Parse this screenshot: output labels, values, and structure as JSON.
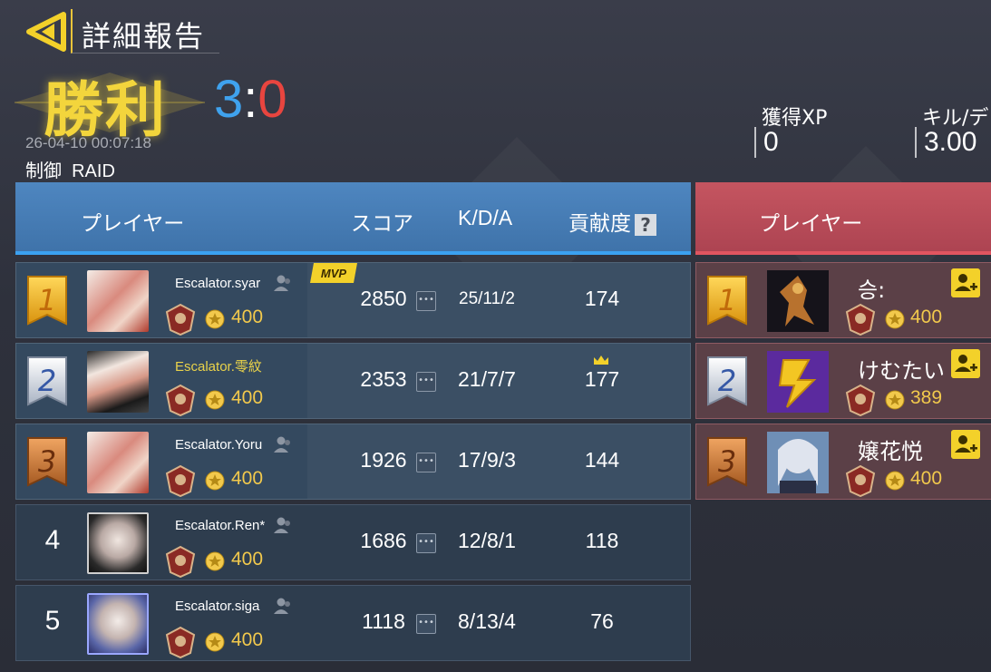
{
  "header": {
    "title": "詳細報告",
    "result": "勝利",
    "score_blue": "3",
    "score_sep": ":",
    "score_red": "0",
    "datetime": "26-04-10 00:07:18",
    "mode": "制御  RAID",
    "stats": [
      {
        "label": "獲得XP",
        "value": "0"
      },
      {
        "label": "キル/デ",
        "value": "3.00"
      }
    ]
  },
  "blue_table": {
    "headers": {
      "player": "プレイヤー",
      "score": "スコア",
      "kda": "K/D/A",
      "contribution": "貢献度",
      "help": "?"
    },
    "rows": [
      {
        "rank": "1",
        "name": "Escalator.syar",
        "points": "400",
        "score": "2850",
        "kda": "25/11/2",
        "contribution": "174",
        "mvp": "MVP"
      },
      {
        "rank": "2",
        "name": "Escalator.零紋",
        "points": "400",
        "score": "2353",
        "kda": "21/7/7",
        "contribution": "177"
      },
      {
        "rank": "3",
        "name": "Escalator.Yoru",
        "points": "400",
        "score": "1926",
        "kda": "17/9/3",
        "contribution": "144"
      },
      {
        "rank": "4",
        "name": "Escalator.Ren*",
        "points": "400",
        "score": "1686",
        "kda": "12/8/1",
        "contribution": "118"
      },
      {
        "rank": "5",
        "name": "Escalator.siga",
        "points": "400",
        "score": "1118",
        "kda": "8/13/4",
        "contribution": "76"
      }
    ]
  },
  "red_table": {
    "headers": {
      "player": "プレイヤー"
    },
    "rows": [
      {
        "rank": "1",
        "name": "승:",
        "points": "400"
      },
      {
        "rank": "2",
        "name": "けむたい",
        "points": "389"
      },
      {
        "rank": "3",
        "name": "嬢花悦",
        "points": "400"
      }
    ]
  },
  "colors": {
    "accent_gold": "#f3d53c",
    "blue": "#3fa2ee",
    "red": "#e8453f",
    "points": "#f2c94c"
  }
}
